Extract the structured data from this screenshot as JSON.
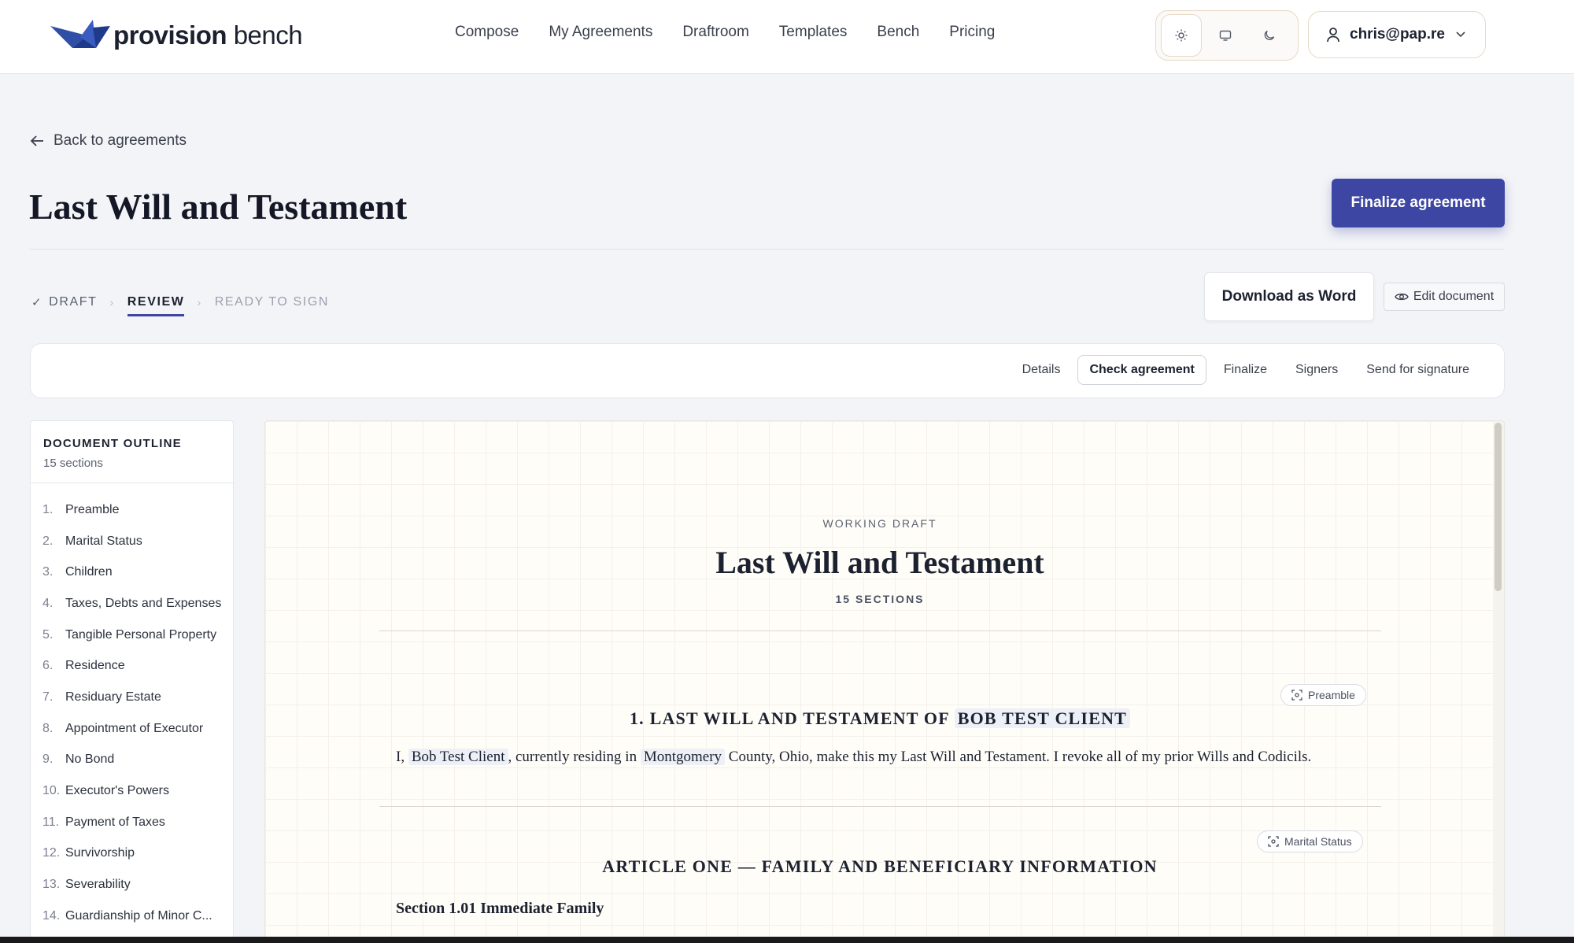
{
  "app": {
    "logo_bold": "provision",
    "logo_light": " bench"
  },
  "nav": {
    "items": [
      "Compose",
      "My Agreements",
      "Draftroom",
      "Templates",
      "Bench",
      "Pricing"
    ]
  },
  "theme": {
    "icons": [
      "sun-icon",
      "monitor-icon",
      "moon-icon"
    ],
    "active": "sun-icon"
  },
  "user": {
    "email": "chris@pap.re"
  },
  "header": {
    "back_label": "Back to agreements",
    "title": "Last Will and Testament",
    "finalize_label": "Finalize agreement"
  },
  "steps": {
    "draft": "DRAFT",
    "review": "REVIEW",
    "ready": "READY TO SIGN"
  },
  "actions": {
    "download_label": "Download as Word",
    "edit_label": "Edit document"
  },
  "tabs": {
    "items": [
      "Details",
      "Check agreement",
      "Finalize",
      "Signers",
      "Send for signature"
    ],
    "active": "Check agreement"
  },
  "outline": {
    "title": "DOCUMENT OUTLINE",
    "count": "15 sections",
    "items": [
      {
        "num": "1.",
        "label": "Preamble"
      },
      {
        "num": "2.",
        "label": "Marital Status"
      },
      {
        "num": "3.",
        "label": "Children"
      },
      {
        "num": "4.",
        "label": "Taxes, Debts and Expenses"
      },
      {
        "num": "5.",
        "label": "Tangible Personal Property"
      },
      {
        "num": "6.",
        "label": "Residence"
      },
      {
        "num": "7.",
        "label": "Residuary Estate"
      },
      {
        "num": "8.",
        "label": "Appointment of Executor"
      },
      {
        "num": "9.",
        "label": "No Bond"
      },
      {
        "num": "10.",
        "label": "Executor's Powers"
      },
      {
        "num": "11.",
        "label": "Payment of Taxes"
      },
      {
        "num": "12.",
        "label": "Survivorship"
      },
      {
        "num": "13.",
        "label": "Severability"
      },
      {
        "num": "14.",
        "label": "Guardianship of Minor C..."
      }
    ]
  },
  "document": {
    "status_label": "WORKING DRAFT",
    "title": "Last Will and Testament",
    "sections_label": "15 SECTIONS",
    "sec1": {
      "tag": "Preamble",
      "title_prefix": "1. LAST WILL AND TESTAMENT OF ",
      "title_name": "BOB TEST CLIENT",
      "para_1": "I, ",
      "client_name": "Bob Test Client",
      "para_2": ", currently residing in ",
      "county": "Montgomery",
      "para_3": " County, Ohio, make this my Last Will and Testament. I revoke all of my prior Wills and Codicils."
    },
    "sec2": {
      "tag": "Marital Status",
      "title": "ARTICLE ONE — FAMILY AND BENEFICIARY INFORMATION",
      "subsection": "Section 1.01 Immediate Family"
    }
  }
}
